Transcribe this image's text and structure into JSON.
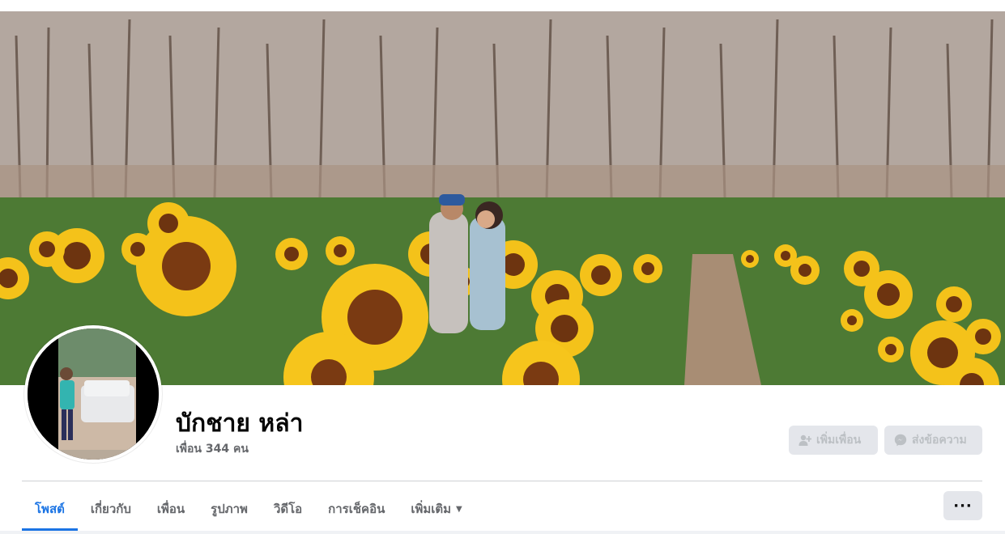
{
  "profile": {
    "name": "บักชาย หล่า",
    "friends": "เพื่อน 344 คน"
  },
  "actions": {
    "add_friend": "เพิ่มเพื่อน",
    "message": "ส่งข้อความ"
  },
  "tabs": [
    {
      "label": "โพสต์",
      "active": true
    },
    {
      "label": "เกี่ยวกับ",
      "active": false
    },
    {
      "label": "เพื่อน",
      "active": false
    },
    {
      "label": "รูปภาพ",
      "active": false
    },
    {
      "label": "วิดีโอ",
      "active": false
    },
    {
      "label": "การเช็คอิน",
      "active": false
    },
    {
      "label": "เพิ่มเติม",
      "active": false
    }
  ],
  "more_menu": "···",
  "icons": {
    "add_friend": "person-plus-icon",
    "message": "messenger-icon",
    "dropdown": "caret-down-icon"
  },
  "colors": {
    "accent": "#1b74e4",
    "button_bg": "#e4e6eb",
    "muted_text": "#65676b",
    "disabled_text": "#bcc0c4"
  }
}
